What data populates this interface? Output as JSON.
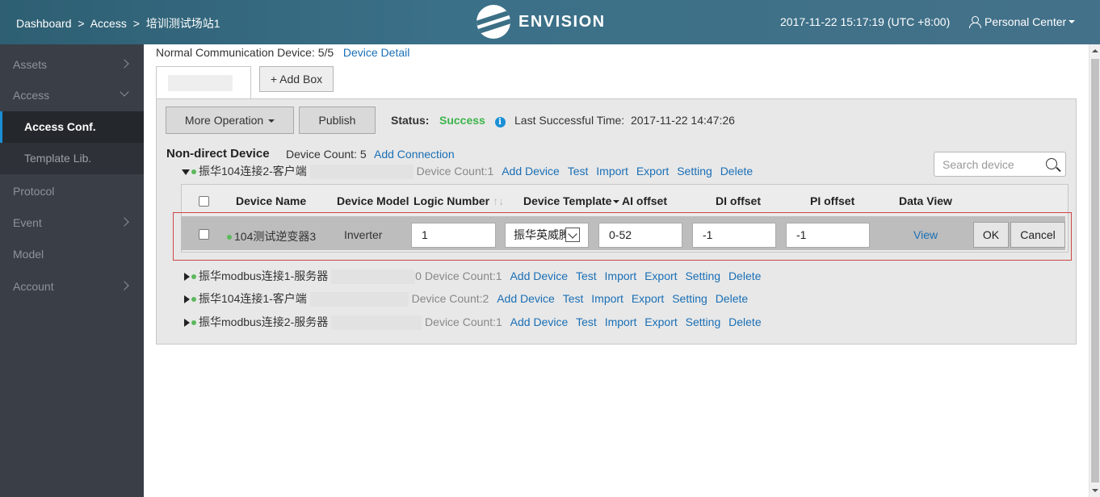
{
  "header": {
    "breadcrumb": [
      "Dashboard",
      ">",
      "Access",
      ">",
      "培训测试场站1"
    ],
    "logo_text": "ENVISION",
    "datetime": "2017-11-22 15:17:19 (UTC +8:00)",
    "user_menu": "Personal Center"
  },
  "sidebar": {
    "items": [
      {
        "label": "Assets"
      },
      {
        "label": "Access"
      },
      {
        "label": "Access Conf."
      },
      {
        "label": "Template Lib."
      },
      {
        "label": "Protocol"
      },
      {
        "label": "Event"
      },
      {
        "label": "Model"
      },
      {
        "label": "Account"
      }
    ]
  },
  "main": {
    "normal_comm_label": "Normal Communication Device: 5/5",
    "device_detail_link": "Device Detail",
    "add_box_label": "+ Add Box",
    "more_op_label": "More Operation",
    "publish_label": "Publish",
    "status_label": "Status:",
    "status_value": "Success",
    "info_glyph": "i",
    "last_time_label": "Last Successful Time:",
    "last_time_value": "2017-11-22 14:47:26",
    "nd_title": "Non-direct Device",
    "nd_count": "Device Count: 5",
    "add_connection": "Add Connection",
    "search_placeholder": "Search device",
    "actions": [
      "Add Device",
      "Test",
      "Import",
      "Export",
      "Setting",
      "Delete"
    ],
    "connections": [
      {
        "name": "振华104连接2-客户端",
        "prefix": "",
        "count": "Device Count:1"
      },
      {
        "name": "振华modbus连接1-服务器",
        "prefix": "0",
        "count": "Device Count:1"
      },
      {
        "name": "振华104连接1-客户端",
        "prefix": "",
        "count": "Device Count:2"
      },
      {
        "name": "振华modbus连接2-服务器",
        "prefix": "",
        "count": "Device Count:1"
      }
    ],
    "columns": [
      "Device Name",
      "Device Model",
      "Logic Number",
      "Device Template",
      "AI offset",
      "DI offset",
      "PI offset",
      "Data View"
    ],
    "sort_glyph": "↑↓",
    "row": {
      "device_name": "104测试逆变器3",
      "device_model": "Inverter",
      "logic_number": "1",
      "template": "振华英威腾",
      "ai_offset": "0-52",
      "di_offset": "-1",
      "pi_offset": "-1",
      "view_link": "View",
      "ok_label": "OK",
      "cancel_label": "Cancel"
    }
  }
}
